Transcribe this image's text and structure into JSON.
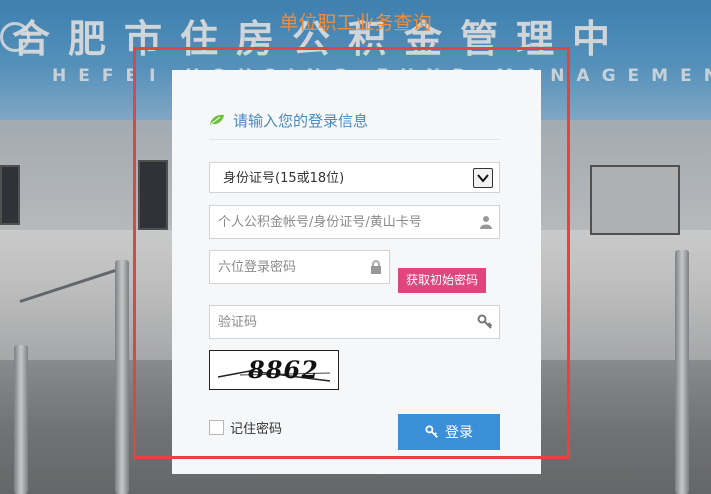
{
  "page": {
    "title": "单位职工业务查询"
  },
  "background": {
    "banner_cn": "合肥市住房公积金管理中",
    "banner_en": "HEFEI HOUSING FUND MANAGEMENT CE"
  },
  "login": {
    "header": "请输入您的登录信息",
    "id_type": {
      "selected": "身份证号(15或18位)",
      "options": [
        "身份证号(15或18位)"
      ]
    },
    "account_placeholder": "个人公积金帐号/身份证号/黄山卡号",
    "password_placeholder": "六位登录密码",
    "init_password_button": "获取初始密码",
    "captcha_placeholder": "验证码",
    "captcha_code": "8862",
    "remember_label": "记住密码",
    "submit_label": "登录"
  },
  "colors": {
    "title": "#f08c3a",
    "frame": "#e0463f",
    "header_text": "#4a8abf",
    "init_button": "#e0457b",
    "login_button": "#3a8fd8"
  }
}
